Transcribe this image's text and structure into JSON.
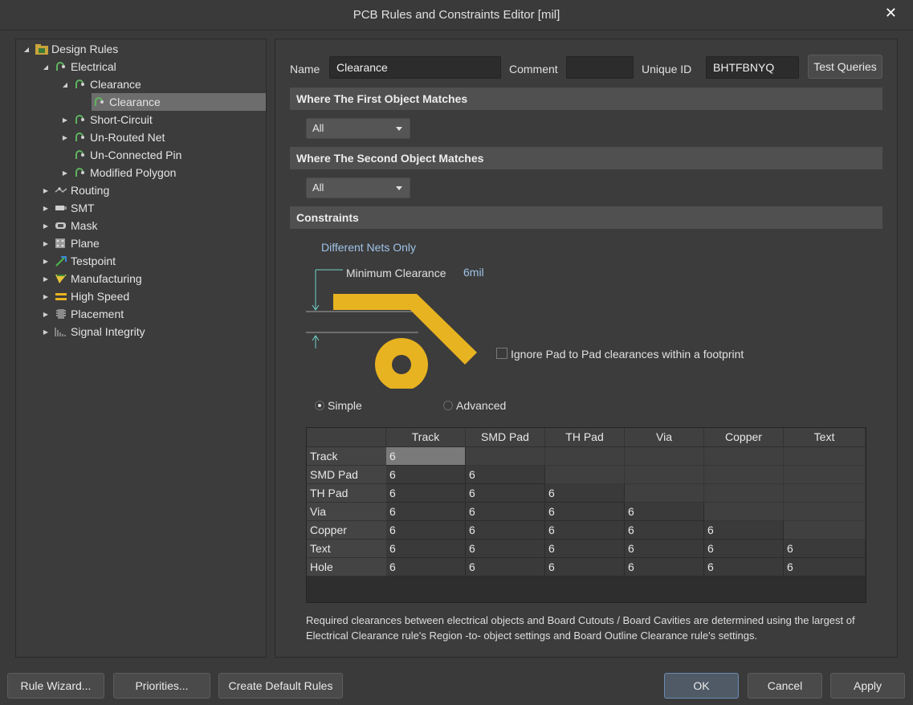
{
  "window": {
    "title": "PCB Rules and Constraints Editor [mil]",
    "close_glyph": "✕"
  },
  "tree": {
    "root": "Design Rules",
    "electrical": "Electrical",
    "clearance_group": "Clearance",
    "clearance_rule": "Clearance",
    "short_circuit": "Short-Circuit",
    "unrouted_net": "Un-Routed Net",
    "unconnected_pin": "Un-Connected Pin",
    "modified_polygon": "Modified Polygon",
    "routing": "Routing",
    "smt": "SMT",
    "mask": "Mask",
    "plane": "Plane",
    "testpoint": "Testpoint",
    "manufacturing": "Manufacturing",
    "high_speed": "High Speed",
    "placement": "Placement",
    "signal_integrity": "Signal Integrity"
  },
  "header": {
    "name_label": "Name",
    "name_value": "Clearance",
    "comment_label": "Comment",
    "comment_value": "",
    "uid_label": "Unique ID",
    "uid_value": "BHTFBNYQ",
    "test_queries": "Test Queries"
  },
  "first_match": {
    "title": "Where The First Object Matches",
    "value": "All"
  },
  "second_match": {
    "title": "Where The Second Object Matches",
    "value": "All"
  },
  "constraints": {
    "title": "Constraints",
    "different_nets": "Different Nets Only",
    "min_clearance_label": "Minimum Clearance",
    "min_clearance_value": "6mil",
    "ignore_pad_label": "Ignore Pad to Pad clearances within a footprint",
    "ignore_pad_checked": false,
    "mode_simple": "Simple",
    "mode_advanced": "Advanced",
    "mode_selected": "Simple"
  },
  "matrix": {
    "columns": [
      "Track",
      "SMD Pad",
      "TH Pad",
      "Via",
      "Copper",
      "Text"
    ],
    "rows": [
      {
        "label": "Track",
        "values": [
          "6",
          "",
          "",
          "",
          "",
          ""
        ]
      },
      {
        "label": "SMD Pad",
        "values": [
          "6",
          "6",
          "",
          "",
          "",
          ""
        ]
      },
      {
        "label": "TH Pad",
        "values": [
          "6",
          "6",
          "6",
          "",
          "",
          ""
        ]
      },
      {
        "label": "Via",
        "values": [
          "6",
          "6",
          "6",
          "6",
          "",
          ""
        ]
      },
      {
        "label": "Copper",
        "values": [
          "6",
          "6",
          "6",
          "6",
          "6",
          ""
        ]
      },
      {
        "label": "Text",
        "values": [
          "6",
          "6",
          "6",
          "6",
          "6",
          "6"
        ]
      },
      {
        "label": "Hole",
        "values": [
          "6",
          "6",
          "6",
          "6",
          "6",
          "6"
        ]
      }
    ]
  },
  "note": "Required clearances between electrical objects and Board Cutouts / Board Cavities are determined using the largest of Electrical Clearance rule's Region -to- object settings and Board Outline Clearance rule's settings.",
  "buttons": {
    "rule_wizard": "Rule Wizard...",
    "priorities": "Priorities...",
    "create_default": "Create Default Rules",
    "ok": "OK",
    "cancel": "Cancel",
    "apply": "Apply"
  },
  "colors": {
    "copper": "#e8b320",
    "accent_link": "#9fc3e8",
    "selection": "#6d6d6d"
  }
}
